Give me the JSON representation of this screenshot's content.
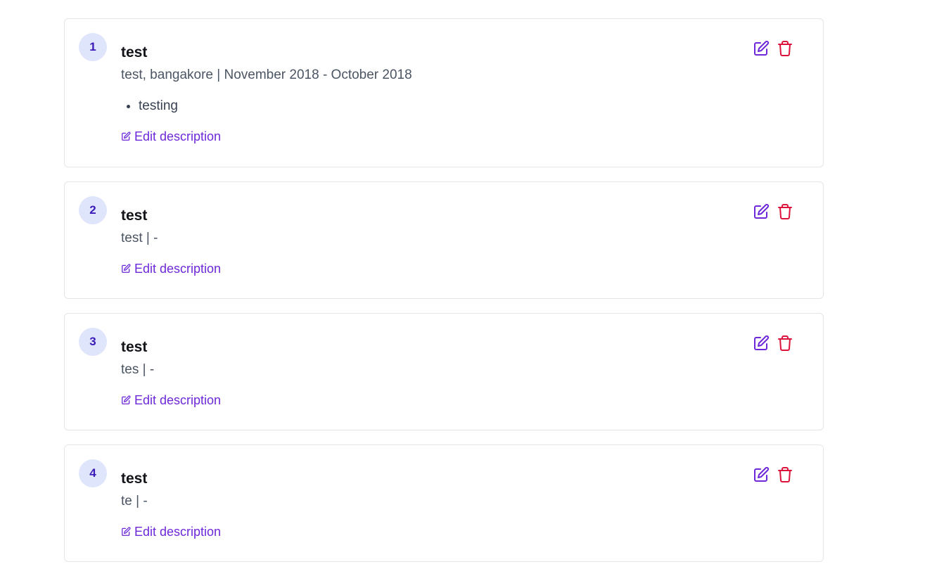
{
  "colors": {
    "badge_bg": "#dfe6fb",
    "badge_text": "#3b1bb8",
    "edit_accent": "#6d28d9",
    "delete_accent": "#dc143c",
    "border": "#e3e5e8"
  },
  "entries": [
    {
      "index": "1",
      "title": "test",
      "subtitle": "test, bangakore | November 2018 - October 2018",
      "bullets": [
        "testing"
      ],
      "edit_description_label": "Edit description",
      "edit_icon": "pencil-square-icon",
      "delete_icon": "trash-icon"
    },
    {
      "index": "2",
      "title": "test",
      "subtitle": "test | -",
      "bullets": [],
      "edit_description_label": "Edit description",
      "edit_icon": "pencil-square-icon",
      "delete_icon": "trash-icon"
    },
    {
      "index": "3",
      "title": "test",
      "subtitle": "tes | -",
      "bullets": [],
      "edit_description_label": "Edit description",
      "edit_icon": "pencil-square-icon",
      "delete_icon": "trash-icon"
    },
    {
      "index": "4",
      "title": "test",
      "subtitle": "te | -",
      "bullets": [],
      "edit_description_label": "Edit description",
      "edit_icon": "pencil-square-icon",
      "delete_icon": "trash-icon"
    }
  ]
}
